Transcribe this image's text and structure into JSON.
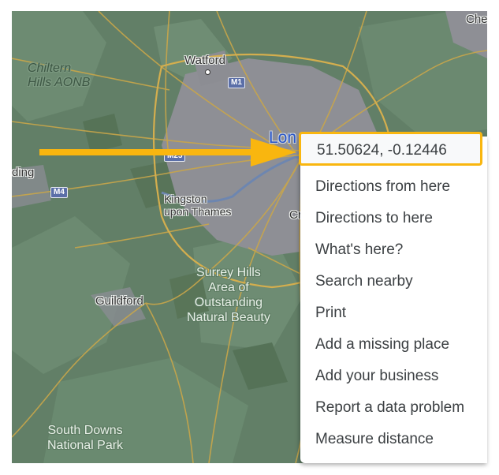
{
  "map": {
    "labels": {
      "chiltern": "Chiltern\nHills AONB",
      "watford": "Watford",
      "london": "Lon",
      "ding": "ding",
      "kingston": "Kingston\nupon Thames",
      "cr": "Cr",
      "surrey": "Surrey Hills\nArea of\nOutstanding\nNatural Beauty",
      "guildford": "Guildford",
      "south_downs": "South Downs\nNational Park",
      "che": "Che"
    },
    "shields": {
      "m1": "M1",
      "m25": "M25",
      "m4": "M4"
    }
  },
  "context_menu": {
    "coordinates": "51.50624, -0.12446",
    "items": [
      "Directions from here",
      "Directions to here",
      "What's here?",
      "Search nearby",
      "Print",
      "Add a missing place",
      "Add your business",
      "Report a data problem",
      "Measure distance"
    ]
  },
  "colors": {
    "highlight": "#f9b60f",
    "arrow": "#f9b60f",
    "map_green": "#627f67",
    "urban": "#8f9096",
    "road": "#c9a64a"
  }
}
